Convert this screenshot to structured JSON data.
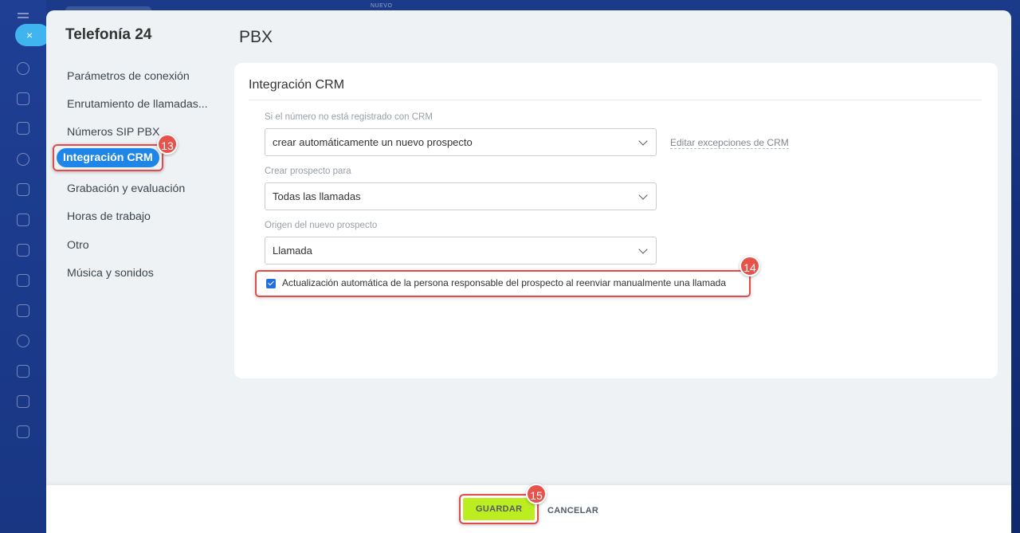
{
  "background": {
    "top_label": "NUEVO"
  },
  "colors": {
    "accent": "#1f86e8",
    "highlight": "#e34b4b",
    "save": "#bbed21",
    "close": "#3fb4ef"
  },
  "rail": {
    "close_icon": "×",
    "icons": [
      "chat-icon",
      "feed-icon",
      "messages-icon",
      "hexagon-icon",
      "calendar-icon",
      "document-icon",
      "presentation-icon",
      "card-icon",
      "mail-icon",
      "contacts-icon",
      "tasks-icon",
      "filter-icon",
      "terminal-icon"
    ]
  },
  "sidebar": {
    "title": "Telefonía 24",
    "items": [
      {
        "label": "Parámetros de conexión"
      },
      {
        "label": "Enrutamiento de llamadas..."
      },
      {
        "label": "Números SIP PBX"
      },
      {
        "label": "Integración CRM",
        "active": true
      },
      {
        "label": "Grabación y evaluación"
      },
      {
        "label": "Horas de trabajo"
      },
      {
        "label": "Otro"
      },
      {
        "label": "Música y sonidos"
      }
    ]
  },
  "main": {
    "title": "PBX",
    "section_title": "Integración CRM",
    "fields": [
      {
        "label": "Si el número no está registrado con CRM",
        "value": "crear automáticamente un nuevo prospecto"
      },
      {
        "label": "Crear prospecto para",
        "value": "Todas las llamadas"
      },
      {
        "label": "Origen del nuevo prospecto",
        "value": "Llamada"
      }
    ],
    "exceptions_link": "Editar excepciones de CRM",
    "checkbox_label": "Actualización automática de la persona responsable del prospecto al reenviar manualmente una llamada",
    "checkbox_checked": true
  },
  "badges": {
    "b13": "13",
    "b14": "14",
    "b15": "15"
  },
  "footer": {
    "save_label": "GUARDAR",
    "cancel_label": "CANCELAR"
  }
}
